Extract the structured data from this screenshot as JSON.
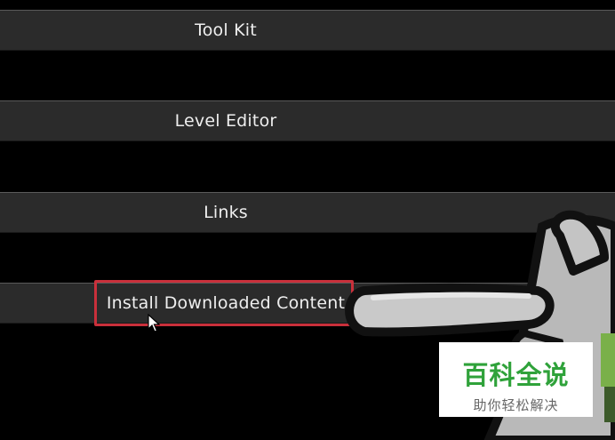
{
  "menu": {
    "items": [
      {
        "label": "Tool Kit"
      },
      {
        "label": "Level Editor"
      },
      {
        "label": "Links"
      },
      {
        "label": "Install Downloaded Content"
      }
    ],
    "highlighted_index": 3
  },
  "colors": {
    "background": "#000000",
    "bar": "#2b2b2b",
    "highlight": "#c9303b",
    "watermark_green": "#2fa23a"
  },
  "watermark": {
    "title": "百科全说",
    "subtitle": "助你轻松解决"
  },
  "icons": {
    "cursor": "arrow-cursor-icon",
    "hand": "pointing-hand-icon"
  }
}
